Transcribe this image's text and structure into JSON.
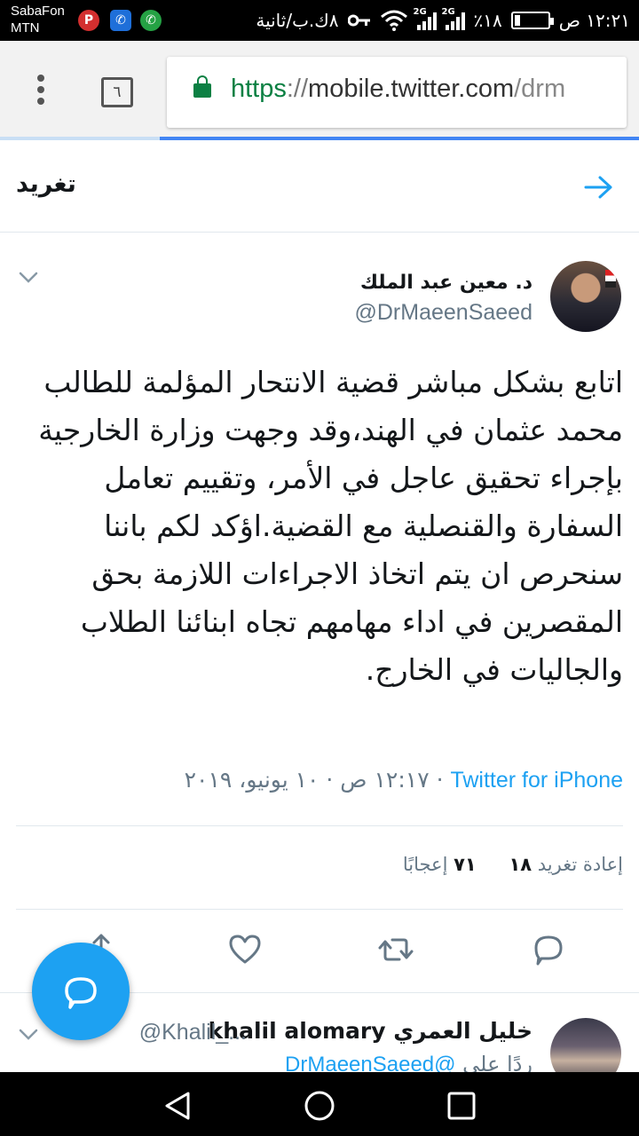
{
  "status_bar": {
    "carrier_line1": "SabaFon",
    "carrier_line2": "MTN",
    "time": "١٢:٢١ ص",
    "battery_level": 0.18,
    "battery_text": "٪١٨",
    "network_label": "2G",
    "data_speed": "٨ك.ب/ثانية",
    "notif_icons": [
      "psiphon-icon",
      "phone-app-icon",
      "whatsapp-icon"
    ]
  },
  "browser": {
    "tab_count": "٦",
    "url_scheme": "https",
    "url_separator": "://",
    "url_host": "mobile.twitter.com",
    "url_path": "/drm",
    "progress": 0.75
  },
  "header": {
    "title": "تغريد"
  },
  "tweet": {
    "display_name": "د. معين عبد الملك",
    "handle": "@DrMaeenSaeed",
    "text": "اتابع بشكل مباشر قضية الانتحار المؤلمة للطالب محمد عثمان في الهند،وقد وجهت وزارة الخارجية بإجراء تحقيق عاجل في الأمر، وتقييم تعامل السفارة والقنصلية مع القضية.اؤكد لكم باننا سنحرص ان يتم اتخاذ الاجراءات اللازمة بحق المقصرين في اداء مهامهم تجاه ابنائنا الطلاب والجاليات في الخارج.",
    "timestamp": "١٢:١٧ ص · ١٠ يونيو، ٢٠١٩",
    "separator": " · ",
    "source": "Twitter for iPhone",
    "retweets_label": "إعادة تغريد",
    "retweets_count": "١٨",
    "likes_label": "إعجابًا",
    "likes_count": "٧١"
  },
  "reply": {
    "display_name": "khalil alomary خليل العمري",
    "handle": "@Khalil_...",
    "reply_to_label": "ردًا على",
    "reply_to_handle": "@DrMaeenSaeed"
  },
  "colors": {
    "twitter_blue": "#1da1f2",
    "secure_green": "#0b8043",
    "muted_text": "#657786"
  }
}
